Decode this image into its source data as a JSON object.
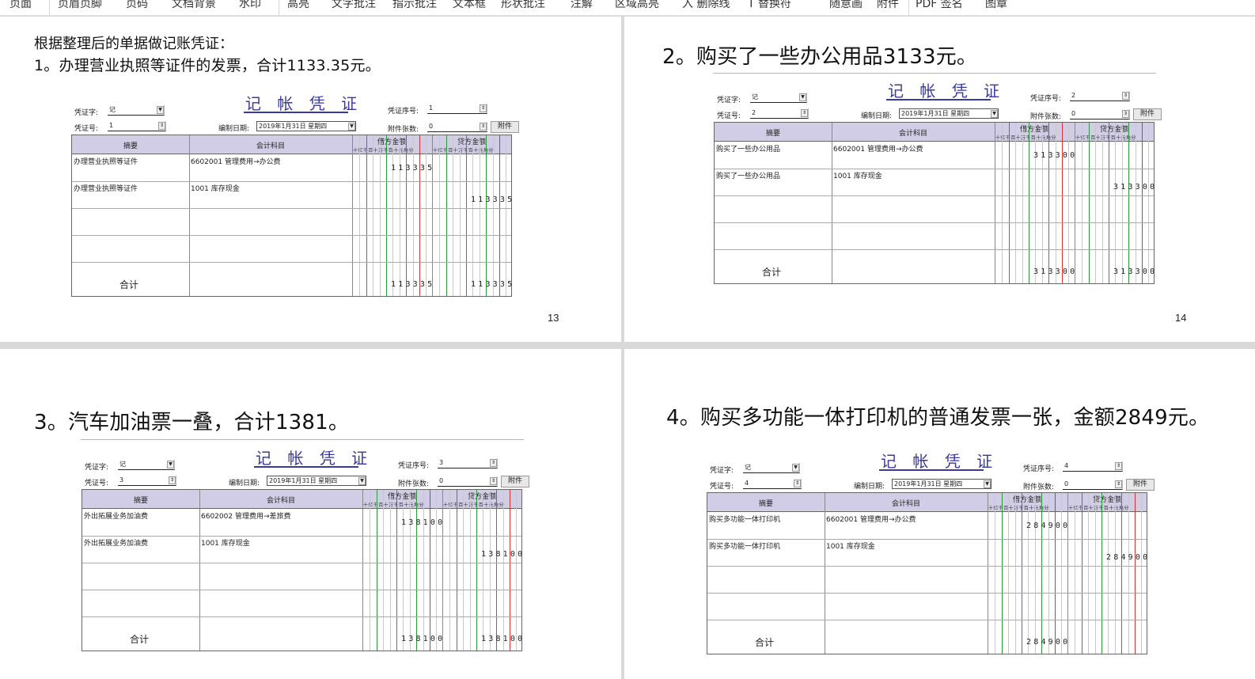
{
  "toolbar": {
    "items": [
      "页面",
      "页眉页脚",
      "页码",
      "文档背景",
      "水印",
      "高亮",
      "文字批注",
      "指示批注",
      "文本框",
      "形状批注",
      "注解",
      "区域高亮",
      "入 删除线",
      "T 替换符",
      "随意画",
      "附件",
      "PDF 签名",
      "图章"
    ]
  },
  "pages": [
    {
      "intro": "根据整理后的单据做记账凭证：",
      "heading": "1。办理营业执照等证件的发票，合计1133.35元。",
      "page_number": "13",
      "voucher": {
        "title": "记 帐 凭 证",
        "voucher_type_label": "凭证字:",
        "voucher_type": "记",
        "voucher_no_label": "凭证号:",
        "voucher_no": "1",
        "date_label": "编制日期:",
        "date": "2019年1月31日 星期四",
        "seq_label": "凭证序号:",
        "seq": "1",
        "attach_count_label": "附件张数:",
        "attach_count": "0",
        "attach_button": "附件",
        "col_summary": "摘要",
        "col_account": "会计科目",
        "col_debit": "借方金额",
        "col_credit": "贷方金额",
        "digit_header": "十亿千百十万千百十元角分",
        "rows": [
          {
            "summary": "办理营业执照等证件",
            "account": "6602001  管理费用→办公费",
            "debit": "113335",
            "credit": ""
          },
          {
            "summary": "办理营业执照等证件",
            "account": "1001  库存现金",
            "debit": "",
            "credit": "113335"
          }
        ],
        "total_label": "合计",
        "total_debit": "113335",
        "total_credit": "113335"
      }
    },
    {
      "heading": "2。购买了一些办公用品3133元。",
      "page_number": "14",
      "voucher": {
        "title": "记 帐 凭 证",
        "voucher_type_label": "凭证字:",
        "voucher_type": "记",
        "voucher_no_label": "凭证号:",
        "voucher_no": "2",
        "date_label": "编制日期:",
        "date": "2019年1月31日 星期四",
        "seq_label": "凭证序号:",
        "seq": "2",
        "attach_count_label": "附件张数:",
        "attach_count": "0",
        "attach_button": "附件",
        "col_summary": "摘要",
        "col_account": "会计科目",
        "col_debit": "借方金额",
        "col_credit": "贷方金额",
        "digit_header": "十亿千百十万千百十元角分",
        "rows": [
          {
            "summary": "购买了一些办公用品",
            "account": "6602001  管理费用→办公费",
            "debit": "313300",
            "credit": ""
          },
          {
            "summary": "购买了一些办公用品",
            "account": "1001  库存现金",
            "debit": "",
            "credit": "313300"
          }
        ],
        "total_label": "合计",
        "total_debit": "313300",
        "total_credit": "313300"
      }
    },
    {
      "heading": "3。汽车加油票一叠，合计1381。",
      "voucher": {
        "title": "记 帐 凭 证",
        "voucher_type_label": "凭证字:",
        "voucher_type": "记",
        "voucher_no_label": "凭证号:",
        "voucher_no": "3",
        "date_label": "编制日期:",
        "date": "2019年1月31日 星期四",
        "seq_label": "凭证序号:",
        "seq": "3",
        "attach_count_label": "附件张数:",
        "attach_count": "0",
        "attach_button": "附件",
        "col_summary": "摘要",
        "col_account": "会计科目",
        "col_debit": "借方金额",
        "col_credit": "贷方金额",
        "digit_header": "十亿千百十万千百十元角分",
        "rows": [
          {
            "summary": "外出拓展业务加油费",
            "account": "6602002  管理费用→差旅费",
            "debit": "138100",
            "credit": ""
          },
          {
            "summary": "外出拓展业务加油费",
            "account": "1001  库存现金",
            "debit": "",
            "credit": "138100"
          }
        ],
        "total_label": "合计",
        "total_debit": "138100",
        "total_credit": "138100"
      }
    },
    {
      "heading": "4。购买多功能一体打印机的普通发票一张，金额2849元。",
      "voucher": {
        "title": "记 帐 凭 证",
        "voucher_type_label": "凭证字:",
        "voucher_type": "记",
        "voucher_no_label": "凭证号:",
        "voucher_no": "4",
        "date_label": "编制日期:",
        "date": "2019年1月31日 星期四",
        "seq_label": "凭证序号:",
        "seq": "4",
        "attach_count_label": "附件张数:",
        "attach_count": "0",
        "attach_button": "附件",
        "col_summary": "摘要",
        "col_account": "会计科目",
        "col_debit": "借方金额",
        "col_credit": "贷方金额",
        "digit_header": "十亿千百十万千百十元角分",
        "rows": [
          {
            "summary": "购买多功能一体打印机",
            "account": "6602001  管理费用→办公费",
            "debit": "284900",
            "credit": ""
          },
          {
            "summary": "购买多功能一体打印机",
            "account": "1001  库存现金",
            "debit": "",
            "credit": "284900"
          }
        ],
        "total_label": "合计",
        "total_debit": "284900",
        "total_credit": ""
      }
    }
  ]
}
